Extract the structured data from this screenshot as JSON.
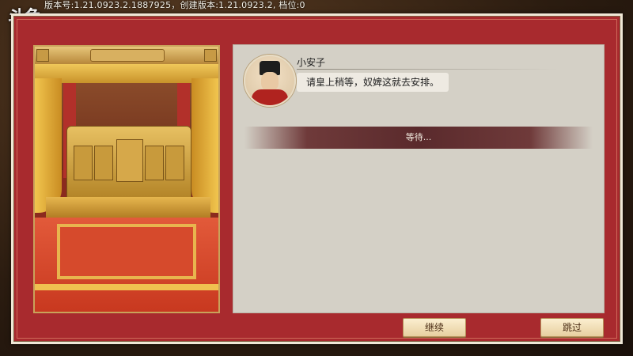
{
  "overlay": {
    "logo": "斗鱼",
    "version": "版本号:1.21.0923.2.1887925，创建版本:1.21.0923.2, 档位:0"
  },
  "dialog": {
    "speaker_name": "小安子",
    "speech_text": "请皇上稍等，奴婢这就去安排。",
    "status_text": "等待..."
  },
  "buttons": {
    "continue_label": "继续",
    "skip_label": "跳过"
  },
  "icons": {
    "avatar": "eunuch-portrait-icon"
  },
  "colors": {
    "frame_red": "#a82a2e",
    "panel_bg": "#d4d0c6",
    "button_gold": "#e7cfa0"
  }
}
